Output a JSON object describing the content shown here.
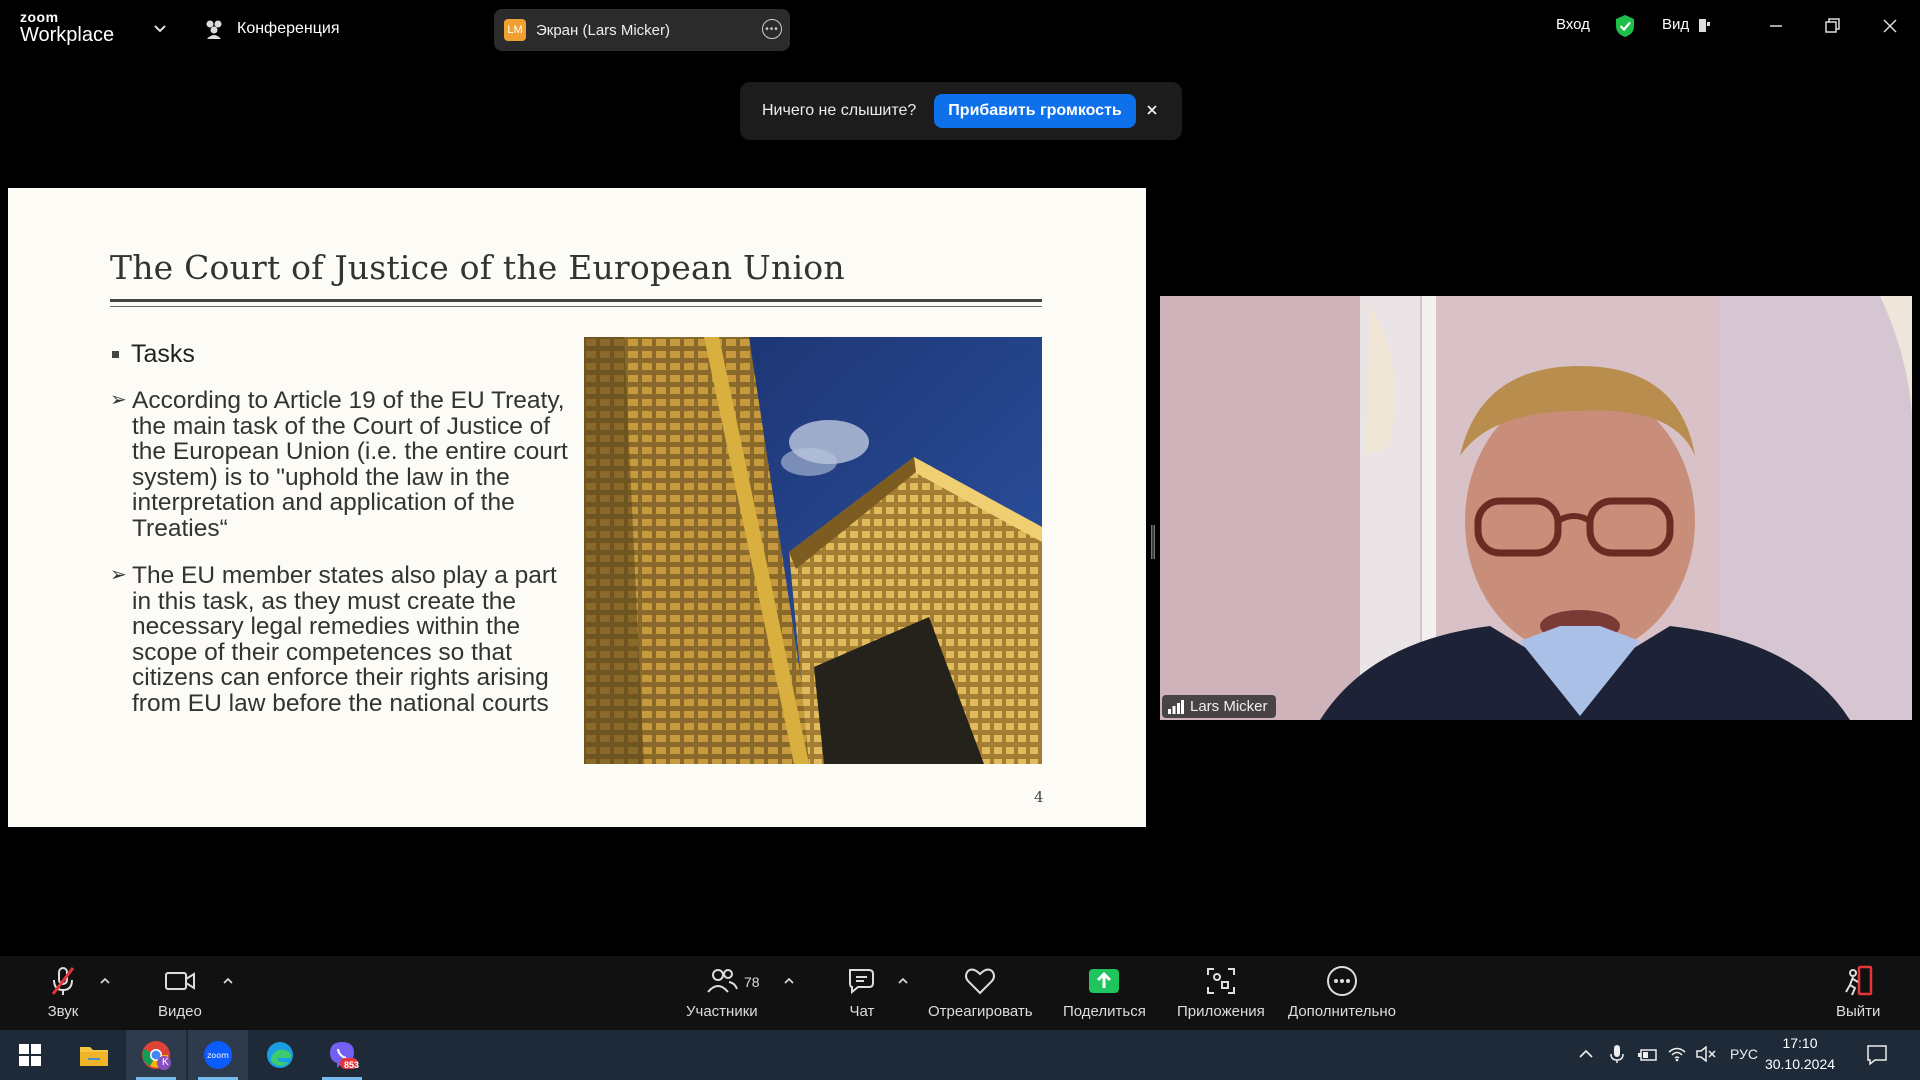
{
  "app": {
    "logo_small": "zoom",
    "logo_big": "Workplace",
    "meeting_label": "Конференция",
    "screen_share": {
      "initials": "LM",
      "label": "Экран (Lars Micker)"
    },
    "signin_label": "Вход",
    "view_label": "Вид"
  },
  "notice": {
    "text": "Ничего не слышите?",
    "button": "Прибавить громкость"
  },
  "slide": {
    "title": "The Court of Justice of the European Union",
    "bullet": "Tasks",
    "paragraph1": "According to Article 19 of the EU Treaty, the main task of the Court of Justice of the European Union (i.e.  the entire court system) is to \"uphold the law in the interpretation and application of the Treaties“",
    "paragraph2": "The EU member states also play a part in this task, as they must create the necessary legal remedies within the scope of their competences so that citizens can enforce their rights arising from EU law before the national courts",
    "page_number": "4"
  },
  "video": {
    "participant_name": "Lars Micker"
  },
  "toolbar": {
    "audio": "Звук",
    "video": "Видео",
    "participants": "Участники",
    "participants_count": "78",
    "chat": "Чат",
    "react": "Отреагировать",
    "share": "Поделиться",
    "apps": "Приложения",
    "more": "Дополнительно",
    "leave": "Выйти"
  },
  "taskbar": {
    "chrome_badge": "K",
    "viber_badge": "853",
    "language": "РУС",
    "time": "17:10",
    "date": "30.10.2024"
  },
  "colors": {
    "accent_blue": "#0e71eb",
    "share_green": "#1fc45c",
    "leave_red": "#e5353a",
    "shield_green": "#1dbf4a"
  }
}
